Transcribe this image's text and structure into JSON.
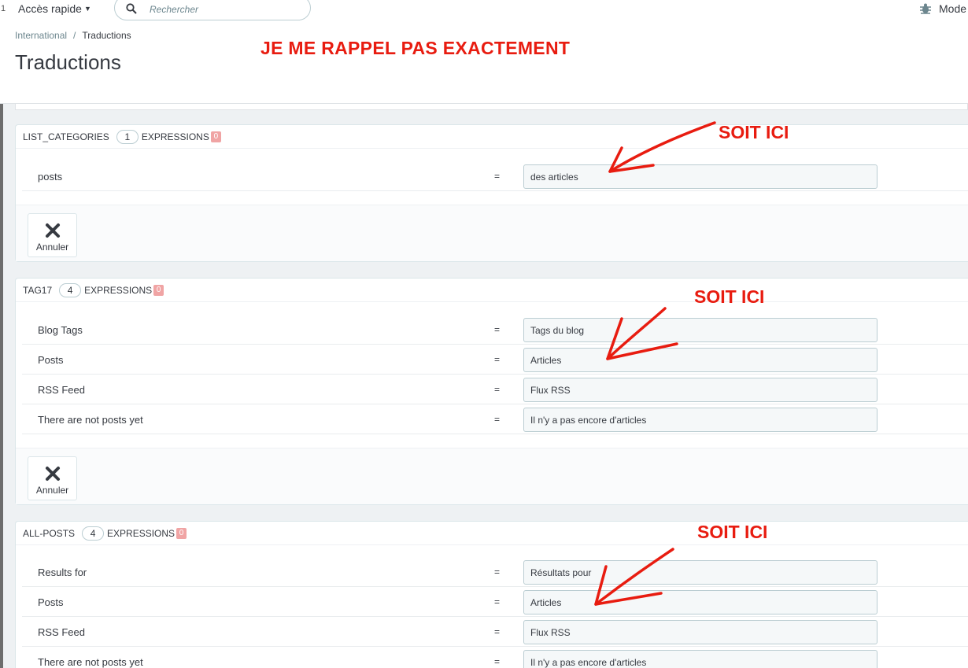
{
  "topbar": {
    "edge_mark": "1",
    "quick_access": "Accès rapide",
    "search_placeholder": "Rechercher",
    "mode_label": "Mode"
  },
  "header": {
    "breadcrumb_parent": "International",
    "breadcrumb_separator": "/",
    "breadcrumb_current": "Traductions",
    "title": "Traductions",
    "annotation": "JE ME RAPPEL PAS EXACTEMENT"
  },
  "annotation_color": "#e81c10",
  "panels": [
    {
      "name": "LIST_CATEGORIES",
      "count": "1",
      "expressions_label": "EXPRESSIONS",
      "missing": "0",
      "rows": [
        {
          "source": "posts",
          "eq": "=",
          "translation": "des articles"
        }
      ],
      "cancel_label": "Annuler",
      "annotation": "SOIT ICI"
    },
    {
      "name": "TAG17",
      "count": "4",
      "expressions_label": "EXPRESSIONS",
      "missing": "0",
      "rows": [
        {
          "source": "Blog Tags",
          "eq": "=",
          "translation": "Tags du blog"
        },
        {
          "source": "Posts",
          "eq": "=",
          "translation": "Articles"
        },
        {
          "source": "RSS Feed",
          "eq": "=",
          "translation": "Flux RSS"
        },
        {
          "source": "There are not posts yet",
          "eq": "=",
          "translation": "Il n'y a pas encore d'articles"
        }
      ],
      "cancel_label": "Annuler",
      "annotation": "SOIT ICI"
    },
    {
      "name": "ALL-POSTS",
      "count": "4",
      "expressions_label": "EXPRESSIONS",
      "missing": "0",
      "rows": [
        {
          "source": "Results for",
          "eq": "=",
          "translation": "Résultats pour"
        },
        {
          "source": "Posts",
          "eq": "=",
          "translation": "Articles"
        },
        {
          "source": "RSS Feed",
          "eq": "=",
          "translation": "Flux RSS"
        },
        {
          "source": "There are not posts yet",
          "eq": "=",
          "translation": "Il n'y a pas encore d'articles"
        }
      ],
      "annotation": "SOIT ICI"
    }
  ]
}
